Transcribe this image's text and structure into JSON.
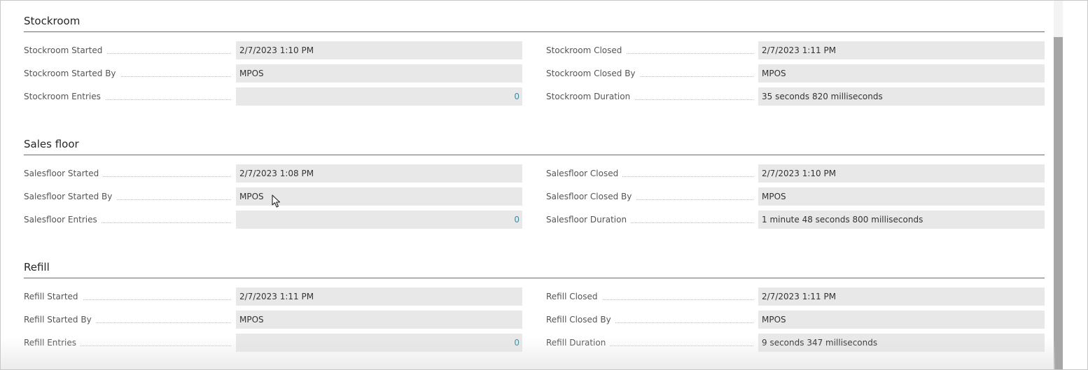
{
  "sections": [
    {
      "title": "Stockroom",
      "left": [
        {
          "label": "Stockroom Started",
          "value": "2/7/2023 1:10 PM"
        },
        {
          "label": "Stockroom Started By",
          "value": "MPOS"
        },
        {
          "label": "Stockroom Entries",
          "value": "0"
        }
      ],
      "right": [
        {
          "label": "Stockroom Closed",
          "value": "2/7/2023 1:11 PM"
        },
        {
          "label": "Stockroom Closed By",
          "value": "MPOS"
        },
        {
          "label": "Stockroom Duration",
          "value": "35 seconds 820 milliseconds"
        }
      ]
    },
    {
      "title": "Sales floor",
      "left": [
        {
          "label": "Salesfloor Started",
          "value": "2/7/2023 1:08 PM"
        },
        {
          "label": "Salesfloor Started By",
          "value": "MPOS"
        },
        {
          "label": "Salesfloor Entries",
          "value": "0"
        }
      ],
      "right": [
        {
          "label": "Salesfloor Closed",
          "value": "2/7/2023 1:10 PM"
        },
        {
          "label": "Salesfloor Closed By",
          "value": "MPOS"
        },
        {
          "label": "Salesfloor Duration",
          "value": "1 minute 48 seconds 800 milliseconds"
        }
      ]
    },
    {
      "title": "Refill",
      "left": [
        {
          "label": "Refill Started",
          "value": "2/7/2023 1:11 PM"
        },
        {
          "label": "Refill Started By",
          "value": "MPOS"
        },
        {
          "label": "Refill Entries",
          "value": "0"
        }
      ],
      "right": [
        {
          "label": "Refill Closed",
          "value": "2/7/2023 1:11 PM"
        },
        {
          "label": "Refill Closed By",
          "value": "MPOS"
        },
        {
          "label": "Refill Duration",
          "value": "9 seconds 347 milliseconds"
        }
      ]
    }
  ],
  "colors": {
    "field_background": "#e8e8e8",
    "number_text": "#3a8fa6",
    "section_rule": "#6b6b6b",
    "scrollbar_thumb": "#a6a6a6"
  },
  "icons": {
    "pointer": "mouse-pointer-icon"
  }
}
